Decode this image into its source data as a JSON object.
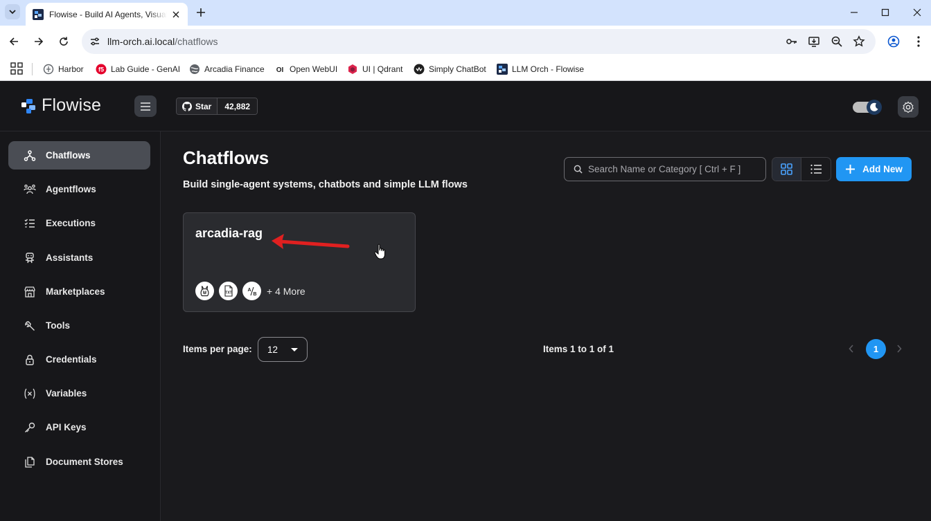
{
  "browser": {
    "tab_title": "Flowise - Build AI Agents, Visual LLM Apps",
    "url_host": "llm-orch.ai.local",
    "url_path": "/chatflows",
    "bookmarks": [
      {
        "label": "Harbor",
        "icon": "harbor-icon"
      },
      {
        "label": "Lab Guide - GenAI",
        "icon": "f5-icon"
      },
      {
        "label": "Arcadia Finance",
        "icon": "globe-icon"
      },
      {
        "label": "Open WebUI",
        "icon": "openwebui-icon"
      },
      {
        "label": "UI | Qdrant",
        "icon": "qdrant-icon"
      },
      {
        "label": "Simply ChatBot",
        "icon": "chatbot-icon"
      },
      {
        "label": "LLM Orch - Flowise",
        "icon": "flowise-icon"
      }
    ]
  },
  "header": {
    "logo_text": "Flowise",
    "github_star_label": "Star",
    "github_star_count": "42,882"
  },
  "sidebar": {
    "items": [
      {
        "label": "Chatflows",
        "icon": "chatflows-icon",
        "active": true
      },
      {
        "label": "Agentflows",
        "icon": "agentflows-icon"
      },
      {
        "label": "Executions",
        "icon": "executions-icon"
      },
      {
        "label": "Assistants",
        "icon": "assistants-icon"
      },
      {
        "label": "Marketplaces",
        "icon": "marketplaces-icon"
      },
      {
        "label": "Tools",
        "icon": "tools-icon"
      },
      {
        "label": "Credentials",
        "icon": "lock-icon"
      },
      {
        "label": "Variables",
        "icon": "variables-icon"
      },
      {
        "label": "API Keys",
        "icon": "key-icon"
      },
      {
        "label": "Document Stores",
        "icon": "document-stores-icon"
      }
    ]
  },
  "main": {
    "title": "Chatflows",
    "subtitle": "Build single-agent systems, chatbots and simple LLM flows",
    "search_placeholder": "Search Name or Category [ Ctrl + F ]",
    "add_new_label": "Add New",
    "cards": [
      {
        "title": "arcadia-rag",
        "node_icons": [
          "ollama-icon",
          "txt-file-icon",
          "ab-icon"
        ],
        "more_label": "+ 4 More"
      }
    ],
    "items_per_page_label": "Items per page:",
    "items_per_page_value": "12",
    "range_label": "Items 1 to 1 of 1",
    "current_page": "1"
  },
  "colors": {
    "accent": "#2196f3",
    "background": "#1a1a1d",
    "annotation_arrow": "#e02020"
  }
}
